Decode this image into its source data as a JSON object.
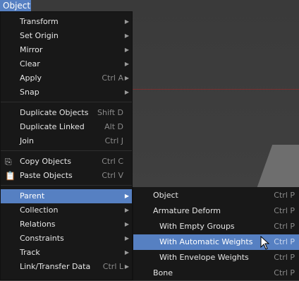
{
  "menubar": {
    "object_label": "Object"
  },
  "menu": {
    "items": [
      {
        "label": "Transform",
        "shortcut": "",
        "submenu": true
      },
      {
        "label": "Set Origin",
        "shortcut": "",
        "submenu": true
      },
      {
        "label": "Mirror",
        "shortcut": "",
        "submenu": true
      },
      {
        "label": "Clear",
        "shortcut": "",
        "submenu": true
      },
      {
        "label": "Apply",
        "shortcut": "Ctrl A",
        "submenu": true
      },
      {
        "label": "Snap",
        "shortcut": "",
        "submenu": true
      },
      {
        "label": "Duplicate Objects",
        "shortcut": "Shift D"
      },
      {
        "label": "Duplicate Linked",
        "shortcut": "Alt D"
      },
      {
        "label": "Join",
        "shortcut": "Ctrl J"
      },
      {
        "label": "Copy Objects",
        "shortcut": "Ctrl C",
        "icon": "copy-icon"
      },
      {
        "label": "Paste Objects",
        "shortcut": "Ctrl V",
        "icon": "paste-icon"
      },
      {
        "label": "Parent",
        "shortcut": "",
        "submenu": true,
        "highlighted": true
      },
      {
        "label": "Collection",
        "shortcut": "",
        "submenu": true
      },
      {
        "label": "Relations",
        "shortcut": "",
        "submenu": true
      },
      {
        "label": "Constraints",
        "shortcut": "",
        "submenu": true
      },
      {
        "label": "Track",
        "shortcut": "",
        "submenu": true
      },
      {
        "label": "Link/Transfer Data",
        "shortcut": "Ctrl L",
        "submenu": true
      }
    ]
  },
  "parent_submenu": {
    "items": [
      {
        "label": "Object",
        "shortcut": "Ctrl P"
      },
      {
        "label": "Armature Deform",
        "shortcut": "Ctrl P"
      },
      {
        "label": "With Empty Groups",
        "shortcut": "Ctrl P"
      },
      {
        "label": "With Automatic Weights",
        "shortcut": "Ctrl P",
        "highlighted": true
      },
      {
        "label": "With Envelope Weights",
        "shortcut": "Ctrl P"
      },
      {
        "label": "Bone",
        "shortcut": "Ctrl P"
      }
    ]
  },
  "colors": {
    "highlight": "#5680c2",
    "menu_bg": "#181818",
    "viewport_bg": "#3d3d3d"
  }
}
